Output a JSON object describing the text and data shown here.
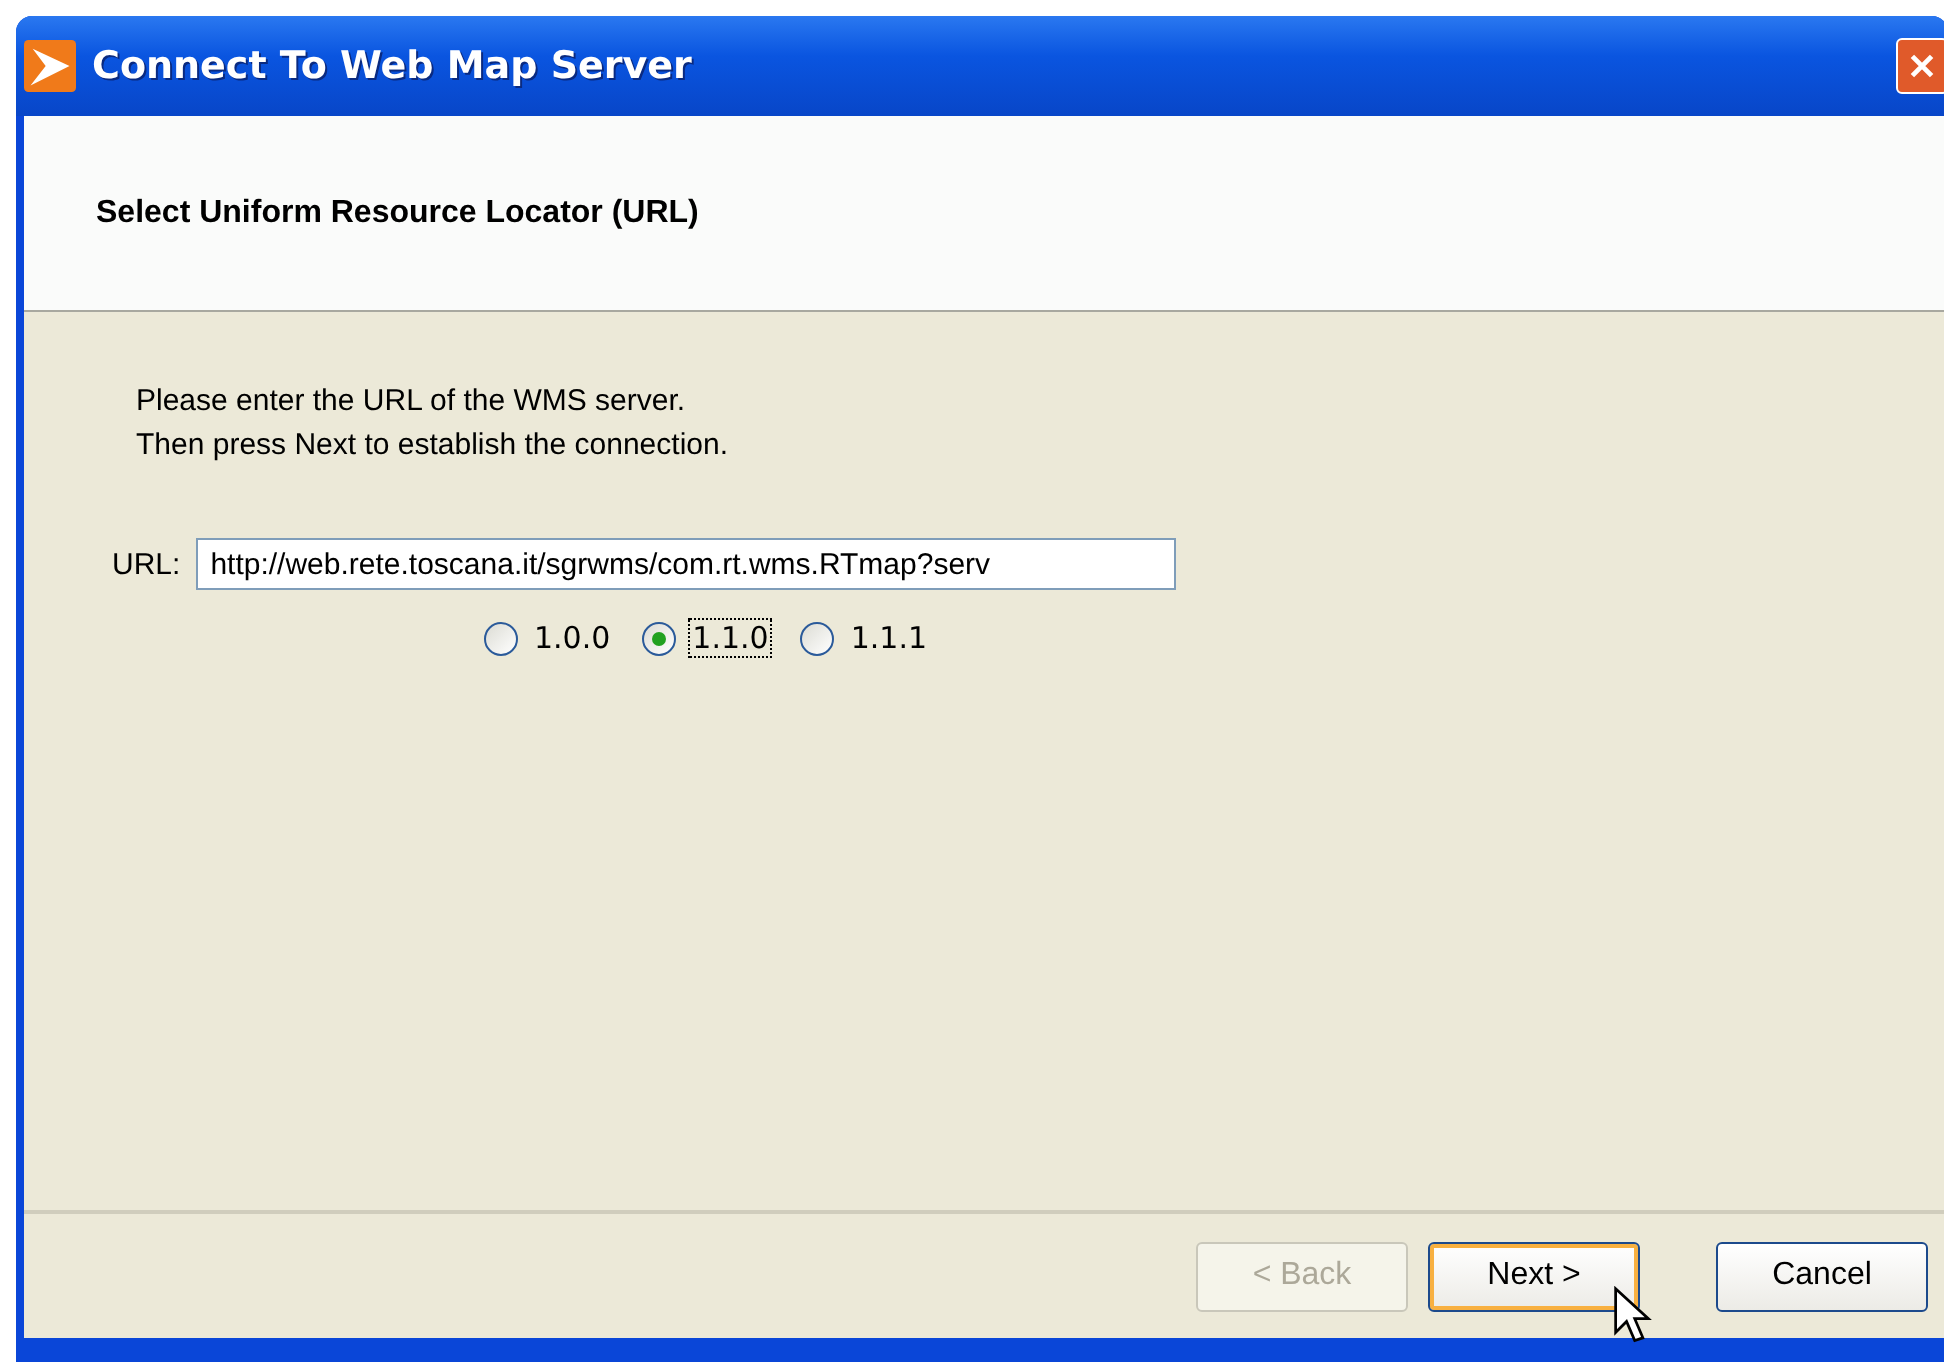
{
  "window": {
    "title": "Connect To Web Map Server"
  },
  "header": {
    "title": "Select Uniform Resource Locator (URL)"
  },
  "instructions": [
    "Please enter the URL of the WMS server.",
    "Then press Next to establish the connection."
  ],
  "url_field": {
    "label": "URL:",
    "value": "http://web.rete.toscana.it/sgrwms/com.rt.wms.RTmap?serv"
  },
  "versions": [
    {
      "label": "1.0.0",
      "selected": false
    },
    {
      "label": "1.1.0",
      "selected": true
    },
    {
      "label": "1.1.1",
      "selected": false
    }
  ],
  "buttons": [
    {
      "label": "< Back",
      "disabled": true,
      "focused": false
    },
    {
      "label": "Next >",
      "disabled": false,
      "focused": true
    },
    {
      "label": "Cancel",
      "disabled": false,
      "focused": false
    }
  ]
}
